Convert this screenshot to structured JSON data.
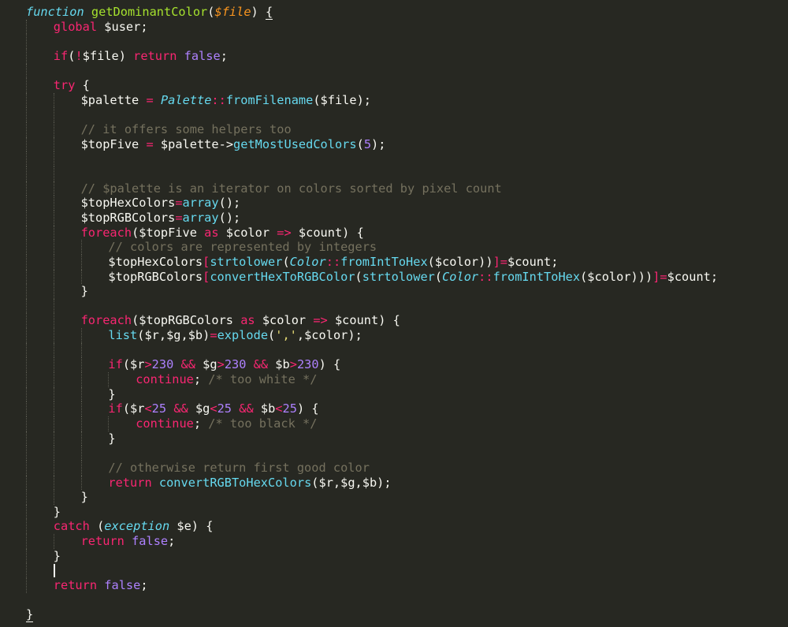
{
  "editor": {
    "lines": [
      {
        "indent": 0,
        "tokens": [
          [
            "func",
            "function"
          ],
          [
            "pun",
            " "
          ],
          [
            "name",
            "getDominantColor"
          ],
          [
            "pun",
            "("
          ],
          [
            "param",
            "$file"
          ],
          [
            "pun",
            ") "
          ],
          [
            "brace",
            "{"
          ]
        ]
      },
      {
        "indent": 1,
        "tokens": [
          [
            "kw",
            "global"
          ],
          [
            "var",
            " $user;"
          ]
        ]
      },
      {
        "indent": 1,
        "tokens": []
      },
      {
        "indent": 1,
        "tokens": [
          [
            "kw",
            "if"
          ],
          [
            "pun",
            "("
          ],
          [
            "op",
            "!"
          ],
          [
            "var",
            "$file"
          ],
          [
            "pun",
            ") "
          ],
          [
            "kw",
            "return"
          ],
          [
            "pun",
            " "
          ],
          [
            "const",
            "false"
          ],
          [
            "pun",
            ";"
          ]
        ]
      },
      {
        "indent": 1,
        "tokens": []
      },
      {
        "indent": 1,
        "tokens": [
          [
            "kw",
            "try"
          ],
          [
            "pun",
            " {"
          ]
        ]
      },
      {
        "indent": 2,
        "tokens": [
          [
            "var",
            "$palette"
          ],
          [
            "pun",
            " "
          ],
          [
            "op",
            "="
          ],
          [
            "pun",
            " "
          ],
          [
            "cls",
            "Palette"
          ],
          [
            "op",
            "::"
          ],
          [
            "call",
            "fromFilename"
          ],
          [
            "pun",
            "($file);"
          ]
        ]
      },
      {
        "indent": 2,
        "tokens": []
      },
      {
        "indent": 2,
        "tokens": [
          [
            "com",
            "// it offers some helpers too"
          ]
        ]
      },
      {
        "indent": 2,
        "tokens": [
          [
            "var",
            "$topFive"
          ],
          [
            "pun",
            " "
          ],
          [
            "op",
            "="
          ],
          [
            "pun",
            " $palette->"
          ],
          [
            "call",
            "getMostUsedColors"
          ],
          [
            "pun",
            "("
          ],
          [
            "num",
            "5"
          ],
          [
            "pun",
            ");"
          ]
        ]
      },
      {
        "indent": 2,
        "tokens": []
      },
      {
        "indent": 2,
        "tokens": []
      },
      {
        "indent": 2,
        "tokens": [
          [
            "com",
            "// $palette is an iterator on colors sorted by pixel count"
          ]
        ]
      },
      {
        "indent": 2,
        "tokens": [
          [
            "var",
            "$topHexColors"
          ],
          [
            "op",
            "="
          ],
          [
            "call",
            "array"
          ],
          [
            "pun",
            "();"
          ]
        ]
      },
      {
        "indent": 2,
        "tokens": [
          [
            "var",
            "$topRGBColors"
          ],
          [
            "op",
            "="
          ],
          [
            "call",
            "array"
          ],
          [
            "pun",
            "();"
          ]
        ]
      },
      {
        "indent": 2,
        "tokens": [
          [
            "kw",
            "foreach"
          ],
          [
            "pun",
            "($topFive "
          ],
          [
            "kw",
            "as"
          ],
          [
            "pun",
            " $color "
          ],
          [
            "op",
            "=>"
          ],
          [
            "pun",
            " $count) {"
          ]
        ]
      },
      {
        "indent": 3,
        "tokens": [
          [
            "com",
            "// colors are represented by integers"
          ]
        ]
      },
      {
        "indent": 3,
        "tokens": [
          [
            "var",
            "$topHexColors"
          ],
          [
            "op",
            "["
          ],
          [
            "call",
            "strtolower"
          ],
          [
            "pun",
            "("
          ],
          [
            "cls",
            "Color"
          ],
          [
            "op",
            "::"
          ],
          [
            "call",
            "fromIntToHex"
          ],
          [
            "pun",
            "($color))"
          ],
          [
            "op",
            "]="
          ],
          [
            "pun",
            "$count;"
          ]
        ]
      },
      {
        "indent": 3,
        "tokens": [
          [
            "var",
            "$topRGBColors"
          ],
          [
            "op",
            "["
          ],
          [
            "call",
            "convertHexToRGBColor"
          ],
          [
            "pun",
            "("
          ],
          [
            "call",
            "strtolower"
          ],
          [
            "pun",
            "("
          ],
          [
            "cls",
            "Color"
          ],
          [
            "op",
            "::"
          ],
          [
            "call",
            "fromIntToHex"
          ],
          [
            "pun",
            "($color)))"
          ],
          [
            "op",
            "]="
          ],
          [
            "pun",
            "$count;"
          ]
        ]
      },
      {
        "indent": 2,
        "tokens": [
          [
            "pun",
            "}"
          ]
        ]
      },
      {
        "indent": 2,
        "tokens": []
      },
      {
        "indent": 2,
        "tokens": [
          [
            "kw",
            "foreach"
          ],
          [
            "pun",
            "($topRGBColors "
          ],
          [
            "kw",
            "as"
          ],
          [
            "pun",
            " $color "
          ],
          [
            "op",
            "=>"
          ],
          [
            "pun",
            " $count) {"
          ]
        ]
      },
      {
        "indent": 3,
        "tokens": [
          [
            "call",
            "list"
          ],
          [
            "pun",
            "($r,$g,$b)"
          ],
          [
            "op",
            "="
          ],
          [
            "call",
            "explode"
          ],
          [
            "pun",
            "("
          ],
          [
            "str",
            "','"
          ],
          [
            "pun",
            ",$color);"
          ]
        ]
      },
      {
        "indent": 3,
        "tokens": []
      },
      {
        "indent": 3,
        "tokens": [
          [
            "kw",
            "if"
          ],
          [
            "pun",
            "($r"
          ],
          [
            "op",
            ">"
          ],
          [
            "num",
            "230"
          ],
          [
            "pun",
            " "
          ],
          [
            "op",
            "&&"
          ],
          [
            "pun",
            " $g"
          ],
          [
            "op",
            ">"
          ],
          [
            "num",
            "230"
          ],
          [
            "pun",
            " "
          ],
          [
            "op",
            "&&"
          ],
          [
            "pun",
            " $b"
          ],
          [
            "op",
            ">"
          ],
          [
            "num",
            "230"
          ],
          [
            "pun",
            ") {"
          ]
        ]
      },
      {
        "indent": 4,
        "tokens": [
          [
            "kw",
            "continue"
          ],
          [
            "pun",
            "; "
          ],
          [
            "com",
            "/* too white */"
          ]
        ]
      },
      {
        "indent": 3,
        "tokens": [
          [
            "pun",
            "}"
          ]
        ]
      },
      {
        "indent": 3,
        "tokens": [
          [
            "kw",
            "if"
          ],
          [
            "pun",
            "($r"
          ],
          [
            "op",
            "<"
          ],
          [
            "num",
            "25"
          ],
          [
            "pun",
            " "
          ],
          [
            "op",
            "&&"
          ],
          [
            "pun",
            " $g"
          ],
          [
            "op",
            "<"
          ],
          [
            "num",
            "25"
          ],
          [
            "pun",
            " "
          ],
          [
            "op",
            "&&"
          ],
          [
            "pun",
            " $b"
          ],
          [
            "op",
            "<"
          ],
          [
            "num",
            "25"
          ],
          [
            "pun",
            ") {"
          ]
        ]
      },
      {
        "indent": 4,
        "tokens": [
          [
            "kw",
            "continue"
          ],
          [
            "pun",
            "; "
          ],
          [
            "com",
            "/* too black */"
          ]
        ]
      },
      {
        "indent": 3,
        "tokens": [
          [
            "pun",
            "}"
          ]
        ]
      },
      {
        "indent": 3,
        "tokens": []
      },
      {
        "indent": 3,
        "tokens": [
          [
            "com",
            "// otherwise return first good color"
          ]
        ]
      },
      {
        "indent": 3,
        "tokens": [
          [
            "kw",
            "return"
          ],
          [
            "pun",
            " "
          ],
          [
            "call",
            "convertRGBToHexColors"
          ],
          [
            "pun",
            "($r,$g,$b);"
          ]
        ]
      },
      {
        "indent": 2,
        "tokens": [
          [
            "pun",
            "}"
          ]
        ]
      },
      {
        "indent": 1,
        "tokens": [
          [
            "pun",
            "}"
          ]
        ]
      },
      {
        "indent": 1,
        "tokens": [
          [
            "kw",
            "catch"
          ],
          [
            "pun",
            " ("
          ],
          [
            "cls",
            "exception"
          ],
          [
            "pun",
            " $e) {"
          ]
        ]
      },
      {
        "indent": 2,
        "tokens": [
          [
            "kw",
            "return"
          ],
          [
            "pun",
            " "
          ],
          [
            "const",
            "false"
          ],
          [
            "pun",
            ";"
          ]
        ]
      },
      {
        "indent": 1,
        "tokens": [
          [
            "pun",
            "}"
          ]
        ]
      },
      {
        "indent": 1,
        "tokens": [],
        "caret": true
      },
      {
        "indent": 1,
        "tokens": [
          [
            "kw",
            "return"
          ],
          [
            "pun",
            " "
          ],
          [
            "const",
            "false"
          ],
          [
            "pun",
            ";"
          ]
        ]
      },
      {
        "indent": 0,
        "tokens": []
      },
      {
        "indent": 0,
        "tokens": [
          [
            "brace",
            "}"
          ]
        ]
      }
    ],
    "colors": {
      "background": "#272822",
      "keyword": "#f92672",
      "function_name": "#a6e22e",
      "builtin_call": "#66d9ef",
      "comment": "#75715e",
      "number": "#ae81ff",
      "string": "#e6db74",
      "parameter": "#fd971f",
      "text": "#f8f8f2"
    }
  }
}
